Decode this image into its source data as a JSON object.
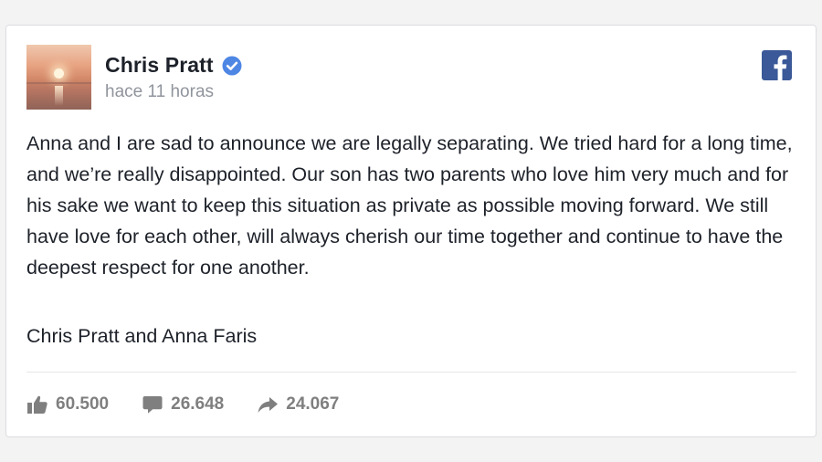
{
  "post": {
    "author_name": "Chris Pratt",
    "timestamp": "hace 11 horas",
    "body": "Anna and I are sad to announce we are legally separating. We tried hard for a long time, and we’re really disappointed. Our son has two parents who love him very much and for his sake we want to keep this situation as private as possible moving forward. We still have love for each other, will always cherish our time together and continue to have the deepest respect for one another.",
    "signature": "Chris Pratt and Anna Faris"
  },
  "stats": {
    "likes": "60.500",
    "comments": "26.648",
    "shares": "24.067"
  },
  "icons": {
    "verified": "verified-badge-icon",
    "brand": "facebook-logo-icon",
    "like": "thumbs-up-icon",
    "comment": "comment-bubble-icon",
    "share": "share-arrow-icon"
  },
  "colors": {
    "facebook_blue": "#3b5998",
    "verified_blue": "#4e86e4",
    "stat_gray": "#7f7f7f",
    "timestamp_gray": "#90949c",
    "text": "#1d2129"
  }
}
